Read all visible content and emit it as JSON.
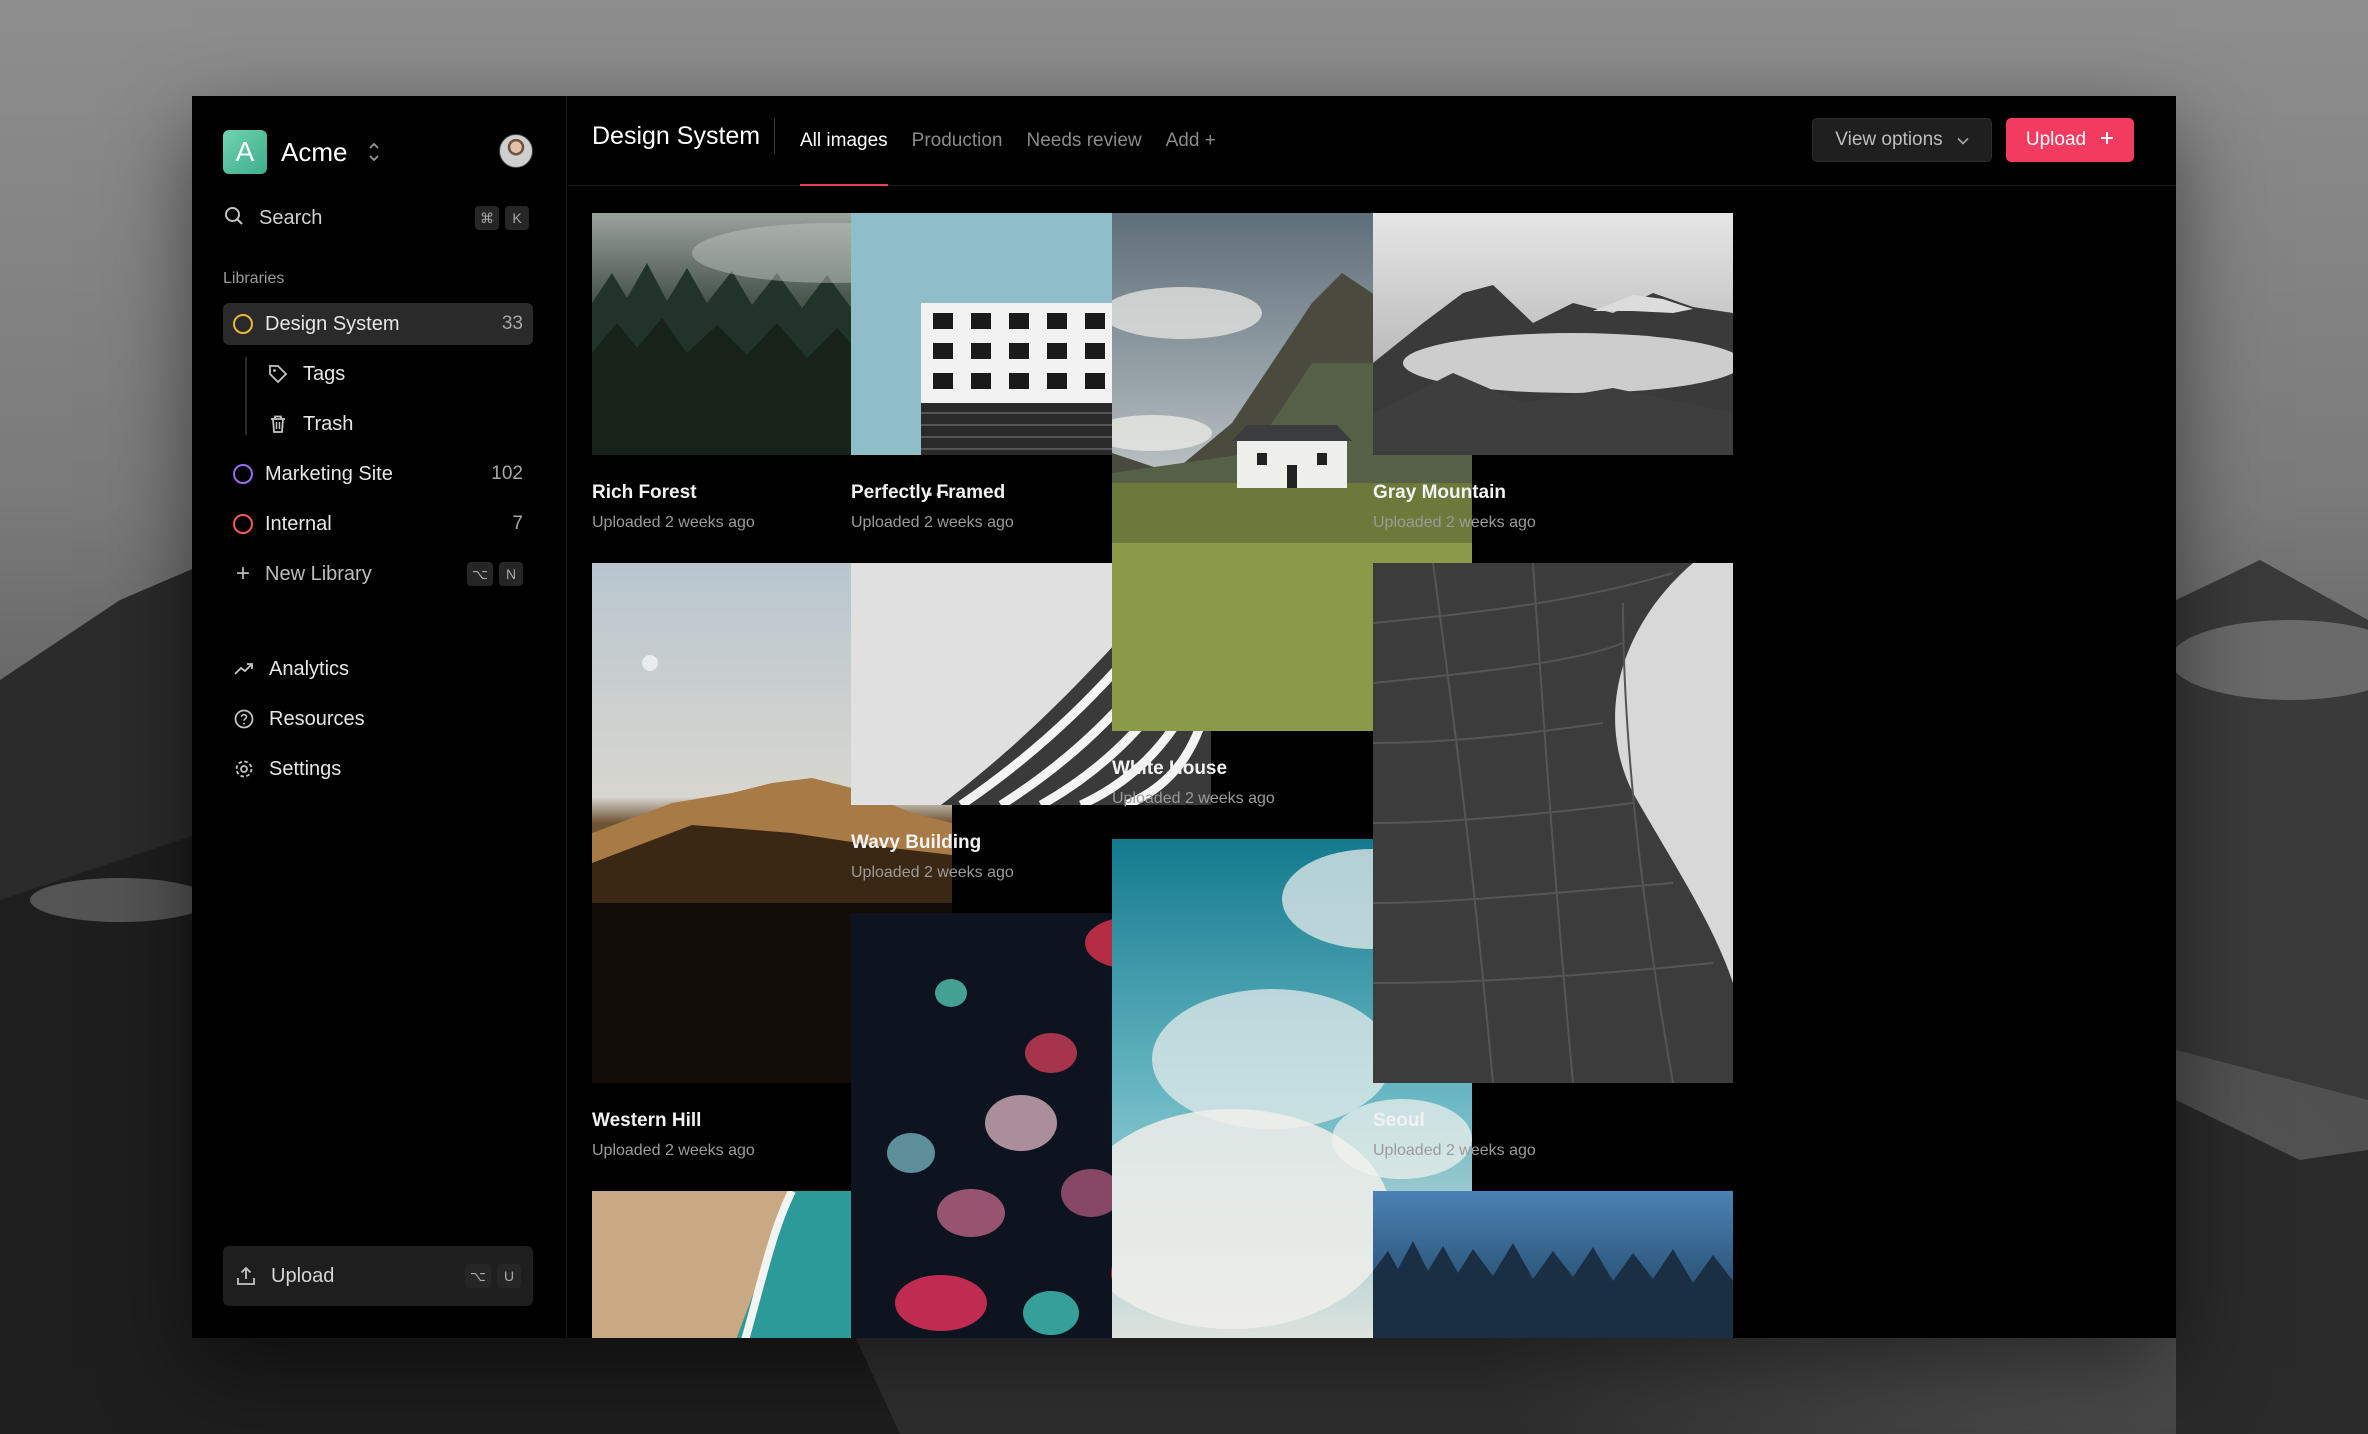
{
  "brand": {
    "letter": "A",
    "name": "Acme"
  },
  "sidebar": {
    "search": {
      "label": "Search",
      "keys": [
        "⌘",
        "K"
      ]
    },
    "section_label": "Libraries",
    "libraries": [
      {
        "label": "Design System",
        "count": "33",
        "color": "#e8b73a"
      },
      {
        "label": "Marketing Site",
        "count": "102",
        "color": "#9b6cf0"
      },
      {
        "label": "Internal",
        "count": "7",
        "color": "#f05a5a"
      }
    ],
    "sub_items": [
      {
        "label": "Tags",
        "icon": "tag-icon"
      },
      {
        "label": "Trash",
        "icon": "trash-icon"
      }
    ],
    "new_library": {
      "label": "New Library",
      "keys": [
        "⌥",
        "N"
      ]
    },
    "nav": [
      {
        "label": "Analytics",
        "icon": "trend-icon"
      },
      {
        "label": "Resources",
        "icon": "help-icon"
      },
      {
        "label": "Settings",
        "icon": "gear-icon"
      }
    ],
    "upload": {
      "label": "Upload",
      "keys": [
        "⌥",
        "U"
      ]
    }
  },
  "header": {
    "title": "Design System",
    "tabs": [
      "All images",
      "Production",
      "Needs review",
      "Add +"
    ],
    "view_options": "View options",
    "upload": "Upload"
  },
  "accent": "#f33a5f",
  "cards": [
    {
      "title": "Rich Forest",
      "sub": "Uploaded 2 weeks ago"
    },
    {
      "title": "Perfectly Framed",
      "sub": "Uploaded 2 weeks ago"
    },
    {
      "title": "White House",
      "sub": "Uploaded 2 weeks ago"
    },
    {
      "title": "Gray Mountain",
      "sub": "Uploaded 2 weeks ago"
    },
    {
      "title": "Western Hill",
      "sub": "Uploaded 2 weeks ago"
    },
    {
      "title": "Wavy Building",
      "sub": "Uploaded 2 weeks ago"
    },
    {
      "title": "Seoul",
      "sub": "Uploaded 2 weeks ago"
    }
  ]
}
